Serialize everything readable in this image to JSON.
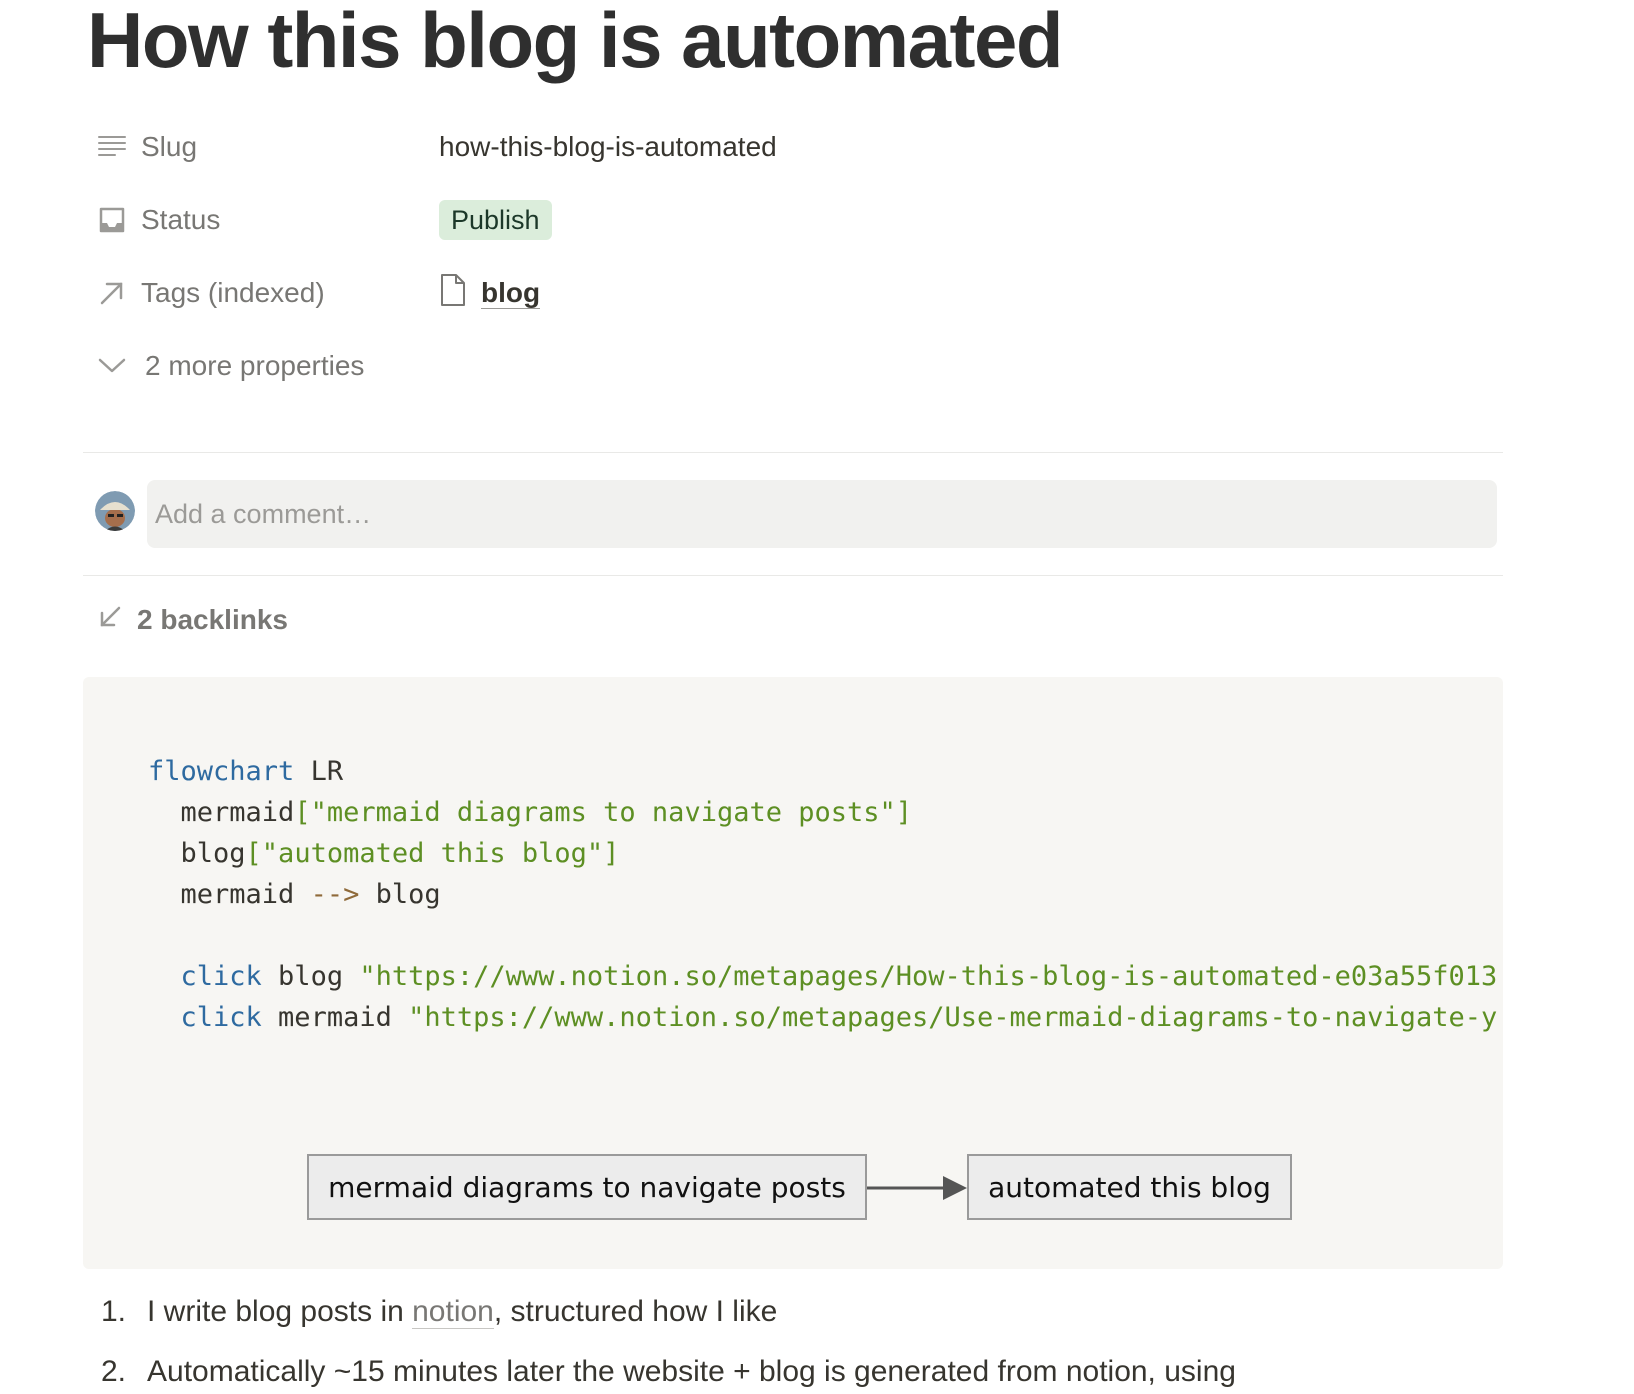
{
  "page": {
    "title": "How this blog is automated"
  },
  "properties": {
    "slug": {
      "name": "Slug",
      "value": "how-this-blog-is-automated",
      "icon": "text-lines-icon"
    },
    "status": {
      "name": "Status",
      "value": "Publish",
      "icon": "inbox-icon",
      "badge_color": "#dbeddb"
    },
    "tags": {
      "name": "Tags (indexed)",
      "value": "blog",
      "icon": "arrow-up-right-icon",
      "value_icon": "page-icon"
    },
    "more": {
      "label": "2 more properties",
      "icon": "chevron-down-icon"
    }
  },
  "comment": {
    "placeholder": "Add a comment…"
  },
  "backlinks": {
    "label": "2 backlinks",
    "icon": "arrow-down-left-icon"
  },
  "code_block": {
    "line1_kw": "flowchart",
    "line1_rest": " LR",
    "line2_id": "mermaid",
    "line2_str": "[\"mermaid diagrams to navigate posts\"]",
    "line3_id": "blog",
    "line3_str": "[\"automated this blog\"]",
    "line4_a": "mermaid ",
    "line4_op": "-->",
    "line4_b": " blog",
    "line6_kw": "click",
    "line6_id": " blog ",
    "line6_str": "\"https://www.notion.so/metapages/How-this-blog-is-automated-e03a55f013",
    "line7_kw": "click",
    "line7_id": " mermaid ",
    "line7_str": "\"https://www.notion.so/metapages/Use-mermaid-diagrams-to-navigate-y"
  },
  "diagram": {
    "node_mermaid": "mermaid diagrams to navigate posts",
    "node_blog": "automated this blog"
  },
  "list": {
    "item1_num": "1.",
    "item1_before": "I write blog posts in ",
    "item1_link": "notion",
    "item1_after": ", structured how I like",
    "item2_num": "2.",
    "item2_text": "Automatically ~15 minutes later the website + blog is generated from notion, using"
  },
  "colors": {
    "keyword": "#2e6aa0",
    "string": "#5d8f23",
    "code_background": "#f7f6f3"
  }
}
